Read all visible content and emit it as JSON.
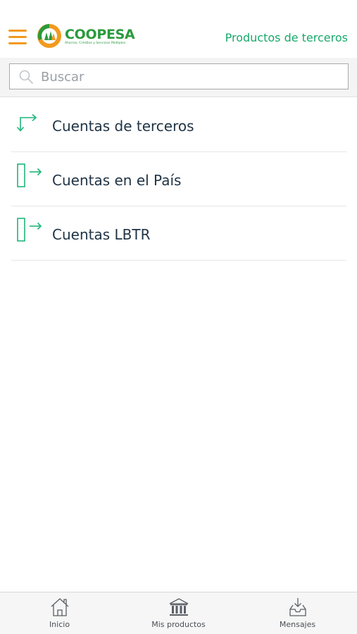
{
  "header": {
    "menu_icon": "hamburger-icon",
    "logo_text": "COOPESA",
    "logo_tagline": "Ahorros, Créditos y Servicios Múltiples",
    "title": "Productos de terceros",
    "accent_color": "#18a86b",
    "menu_color": "#f29a1f"
  },
  "search": {
    "placeholder": "Buscar",
    "value": "",
    "icon": "search-icon"
  },
  "list": {
    "items": [
      {
        "label": "Cuentas de terceros",
        "icon": "transfer-arrows-icon"
      },
      {
        "label": "Cuentas en el País",
        "icon": "account-transfer-icon"
      },
      {
        "label": "Cuentas LBTR",
        "icon": "account-transfer-icon"
      }
    ]
  },
  "tabbar": {
    "tabs": [
      {
        "label": "Inicio",
        "icon": "home-icon"
      },
      {
        "label": "Mis productos",
        "icon": "bank-icon"
      },
      {
        "label": "Mensajes",
        "icon": "inbox-icon"
      }
    ]
  }
}
